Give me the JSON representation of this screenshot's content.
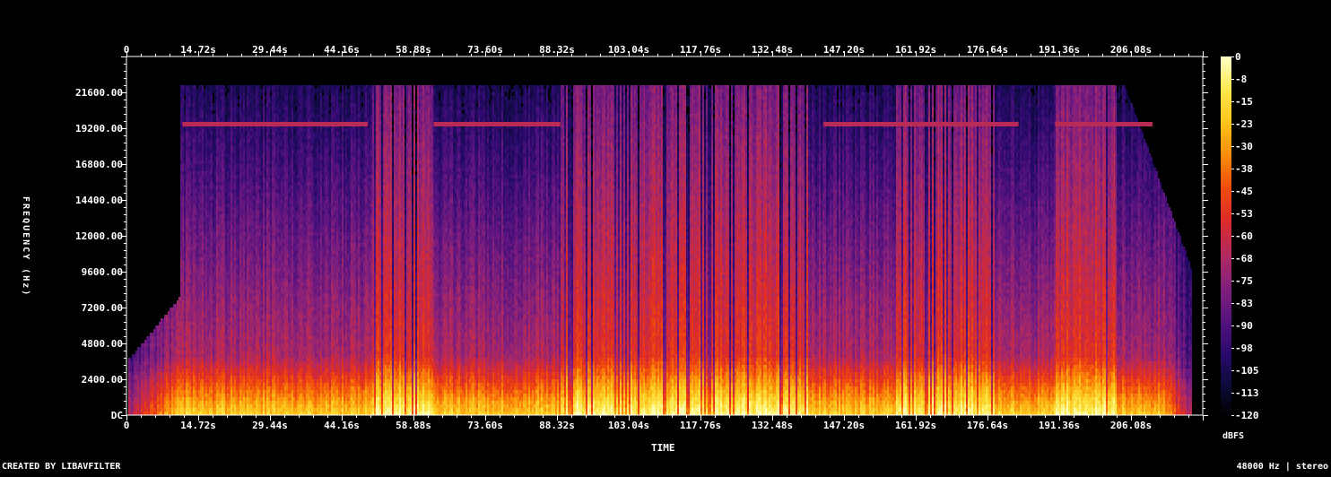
{
  "credit": "CREATED BY LIBAVFILTER",
  "info": "48000 Hz | stereo",
  "chart_data": {
    "type": "heatmap",
    "title": "",
    "xlabel": "TIME",
    "ylabel": "FREQUENCY (Hz)",
    "colorbar_label": "dBFS",
    "x_ticks": [
      "0",
      "14.72s",
      "29.44s",
      "44.16s",
      "58.88s",
      "73.60s",
      "88.32s",
      "103.04s",
      "117.76s",
      "132.48s",
      "147.20s",
      "161.92s",
      "176.64s",
      "191.36s",
      "206.08s"
    ],
    "x_tick_values": [
      0,
      14.72,
      29.44,
      44.16,
      58.88,
      73.6,
      88.32,
      103.04,
      117.76,
      132.48,
      147.2,
      161.92,
      176.64,
      191.36,
      206.08
    ],
    "xlim": [
      0,
      220.8
    ],
    "y_ticks": [
      "DC",
      "2400.00",
      "4800.00",
      "7200.00",
      "9600.00",
      "12000.00",
      "14400.00",
      "16800.00",
      "19200.00",
      "21600.00"
    ],
    "y_tick_values": [
      0,
      2400,
      4800,
      7200,
      9600,
      12000,
      14400,
      16800,
      19200,
      21600
    ],
    "ylim": [
      0,
      24000
    ],
    "colorbar_ticks": [
      "0",
      "-8",
      "-15",
      "-23",
      "-30",
      "-38",
      "-45",
      "-53",
      "-60",
      "-68",
      "-75",
      "-83",
      "-90",
      "-98",
      "-105",
      "-113",
      "-120"
    ],
    "colorbar_range": [
      -120,
      0
    ],
    "signal_start_s": 1.0,
    "signal_end_s": 218.0,
    "lowpass_hz": 22000,
    "tone_line_hz": 19500,
    "dense_sections_s": [
      [
        50.5,
        63.0
      ],
      [
        88.8,
        140.0
      ],
      [
        158.0,
        178.0
      ],
      [
        190.5,
        203.0
      ]
    ],
    "tone_present_s": [
      [
        11.5,
        49.5
      ],
      [
        63.0,
        89.0
      ],
      [
        143.0,
        183.0
      ],
      [
        190.5,
        210.5
      ]
    ],
    "colormap": [
      "#000000",
      "#0c0a3c",
      "#2b0a6e",
      "#58137f",
      "#84207c",
      "#b22a5e",
      "#dc2a2a",
      "#f04a0d",
      "#fb8a09",
      "#fcc21a",
      "#fde84a",
      "#ffffc0"
    ]
  }
}
